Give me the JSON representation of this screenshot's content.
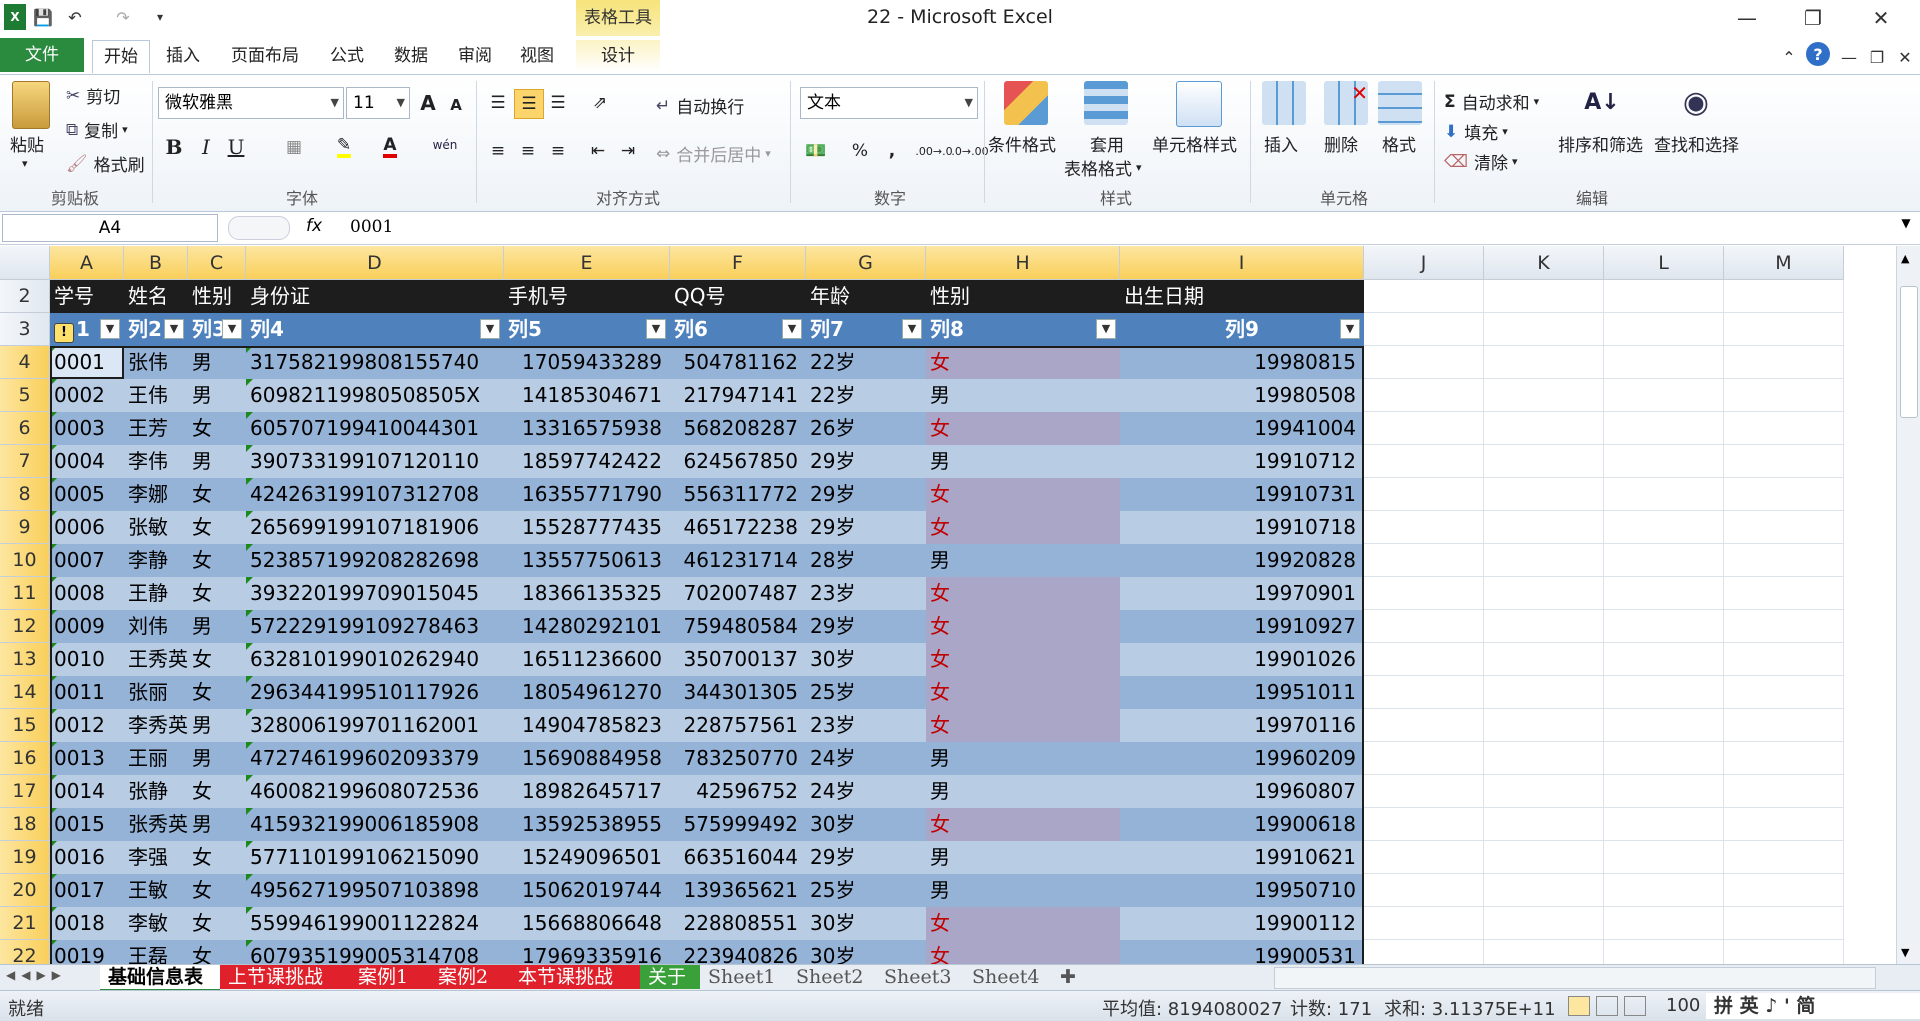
{
  "window": {
    "title": "22 - Microsoft Excel",
    "context_tab_group": "表格工具"
  },
  "ribbon_tabs": [
    "文件",
    "开始",
    "插入",
    "页面布局",
    "公式",
    "数据",
    "审阅",
    "视图",
    "设计"
  ],
  "ribbon": {
    "clipboard": {
      "paste": "粘贴",
      "cut": "剪切",
      "copy": "复制",
      "format_painter": "格式刷",
      "label": "剪贴板"
    },
    "font": {
      "name": "微软雅黑",
      "size": "11",
      "label": "字体",
      "bold": "B",
      "italic": "I",
      "underline": "U",
      "grow": "A",
      "shrink": "A",
      "font_color_letter": "A",
      "phonetic": "wén"
    },
    "alignment": {
      "wrap": "自动换行",
      "merge": "合并后居中",
      "label": "对齐方式"
    },
    "number": {
      "format": "文本",
      "percent": "%",
      "comma": ",",
      "inc_decimal": ".00→.0",
      "dec_decimal": ".0→.00",
      "label": "数字"
    },
    "styles": {
      "conditional": "条件格式",
      "table_line1": "套用",
      "table_line2": "表格格式",
      "cell_styles": "单元格样式",
      "label": "样式"
    },
    "cells": {
      "insert": "插入",
      "delete": "删除",
      "format": "格式",
      "label": "单元格"
    },
    "editing": {
      "autosum": "自动求和",
      "fill": "填充",
      "clear": "清除",
      "sort": "排序和筛选",
      "find": "查找和选择",
      "label": "编辑"
    }
  },
  "formula_bar": {
    "name_box": "A4",
    "fx": "fx",
    "value": "0001"
  },
  "columns": [
    "A",
    "B",
    "C",
    "D",
    "E",
    "F",
    "G",
    "H",
    "I",
    "J",
    "K",
    "L",
    "M"
  ],
  "table": {
    "header": [
      "学号",
      "姓名",
      "性别",
      "身份证",
      "手机号",
      "QQ号",
      "年龄",
      "性别",
      "出生日期"
    ],
    "filter_row": [
      "1",
      "列2",
      "列3",
      "列4",
      "列5",
      "列6",
      "列7",
      "列8",
      "列9"
    ],
    "rows": [
      [
        "0001",
        "张伟",
        "男",
        "317582199808155740",
        "17059433289",
        "504781162",
        "22岁",
        "女",
        "19980815"
      ],
      [
        "0002",
        "王伟",
        "男",
        "60982119980508505X",
        "14185304671",
        "217947141",
        "22岁",
        "男",
        "19980508"
      ],
      [
        "0003",
        "王芳",
        "女",
        "605707199410044301",
        "13316575938",
        "568208287",
        "26岁",
        "女",
        "19941004"
      ],
      [
        "0004",
        "李伟",
        "男",
        "390733199107120110",
        "18597742422",
        "624567850",
        "29岁",
        "男",
        "19910712"
      ],
      [
        "0005",
        "李娜",
        "女",
        "424263199107312708",
        "16355771790",
        "556311772",
        "29岁",
        "女",
        "19910731"
      ],
      [
        "0006",
        "张敏",
        "女",
        "265699199107181906",
        "15528777435",
        "465172238",
        "29岁",
        "女",
        "19910718"
      ],
      [
        "0007",
        "李静",
        "女",
        "523857199208282698",
        "13557750613",
        "461231714",
        "28岁",
        "男",
        "19920828"
      ],
      [
        "0008",
        "王静",
        "女",
        "393220199709015045",
        "18366135325",
        "702007487",
        "23岁",
        "女",
        "19970901"
      ],
      [
        "0009",
        "刘伟",
        "男",
        "572229199109278463",
        "14280292101",
        "759480584",
        "29岁",
        "女",
        "19910927"
      ],
      [
        "0010",
        "王秀英",
        "女",
        "632810199010262940",
        "16511236600",
        "350700137",
        "30岁",
        "女",
        "19901026"
      ],
      [
        "0011",
        "张丽",
        "女",
        "296344199510117926",
        "18054961270",
        "344301305",
        "25岁",
        "女",
        "19951011"
      ],
      [
        "0012",
        "李秀英",
        "男",
        "328006199701162001",
        "14904785823",
        "228757561",
        "23岁",
        "女",
        "19970116"
      ],
      [
        "0013",
        "王丽",
        "男",
        "472746199602093379",
        "15690884958",
        "783250770",
        "24岁",
        "男",
        "19960209"
      ],
      [
        "0014",
        "张静",
        "女",
        "460082199608072536",
        "18982645717",
        "42596752",
        "24岁",
        "男",
        "19960807"
      ],
      [
        "0015",
        "张秀英",
        "男",
        "415932199006185908",
        "13592538955",
        "575999492",
        "30岁",
        "女",
        "19900618"
      ],
      [
        "0016",
        "李强",
        "女",
        "577110199106215090",
        "15249096501",
        "663516044",
        "29岁",
        "男",
        "19910621"
      ],
      [
        "0017",
        "王敏",
        "女",
        "495627199507103898",
        "15062019744",
        "139365621",
        "25岁",
        "男",
        "19950710"
      ],
      [
        "0018",
        "李敏",
        "女",
        "559946199001122824",
        "15668806648",
        "228808551",
        "30岁",
        "女",
        "19900112"
      ],
      [
        "0019",
        "王磊",
        "女",
        "607935199005314708",
        "17969335916",
        "223940826",
        "30岁",
        "女",
        "19900531"
      ]
    ]
  },
  "sheet_tabs": [
    {
      "name": "基础信息表",
      "color": "#ffffff"
    },
    {
      "name": "上节课挑战",
      "color": "#e0202a"
    },
    {
      "name": "案例1",
      "color": "#e0202a"
    },
    {
      "name": "案例2",
      "color": "#e0202a"
    },
    {
      "name": "本节课挑战",
      "color": "#e0202a"
    },
    {
      "name": "关于",
      "color": "#3aa03a"
    },
    {
      "name": "Sheet1",
      "color": ""
    },
    {
      "name": "Sheet2",
      "color": ""
    },
    {
      "name": "Sheet3",
      "color": ""
    },
    {
      "name": "Sheet4",
      "color": ""
    }
  ],
  "status": {
    "ready": "就绪",
    "average": "平均值: 8194080027",
    "count": "计数: 171",
    "sum": "求和: 3.11375E+11",
    "zoom": "100",
    "ime": "拼 英 ♪ ' 简"
  },
  "colors": {
    "header_black": "#1d1d1d",
    "filter_blue": "#4f81bd",
    "band_dark": "#95b3d7",
    "band_light": "#b8cce4",
    "female_fill": "#a9a6c8",
    "female_text": "#c00000",
    "file_tab": "#2a8a3e"
  }
}
